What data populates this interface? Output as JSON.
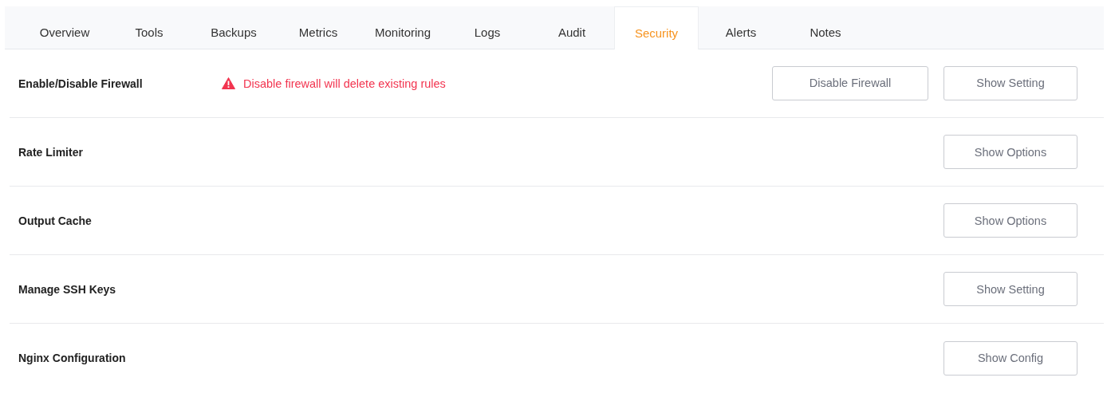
{
  "tabs": [
    {
      "label": "Overview",
      "selected": false
    },
    {
      "label": "Tools",
      "selected": false
    },
    {
      "label": "Backups",
      "selected": false
    },
    {
      "label": "Metrics",
      "selected": false
    },
    {
      "label": "Monitoring",
      "selected": false
    },
    {
      "label": "Logs",
      "selected": false
    },
    {
      "label": "Audit",
      "selected": false
    },
    {
      "label": "Security",
      "selected": true
    },
    {
      "label": "Alerts",
      "selected": false
    },
    {
      "label": "Notes",
      "selected": false
    }
  ],
  "settings": [
    {
      "label": "Enable/Disable Firewall",
      "warning": "Disable firewall will delete existing rules",
      "buttons": [
        "Disable Firewall",
        "Show Setting"
      ]
    },
    {
      "label": "Rate Limiter",
      "buttons": [
        "Show Options"
      ]
    },
    {
      "label": "Output Cache",
      "buttons": [
        "Show Options"
      ]
    },
    {
      "label": "Manage SSH Keys",
      "buttons": [
        "Show Setting"
      ]
    },
    {
      "label": "Nginx Configuration",
      "buttons": [
        "Show Config"
      ]
    }
  ]
}
